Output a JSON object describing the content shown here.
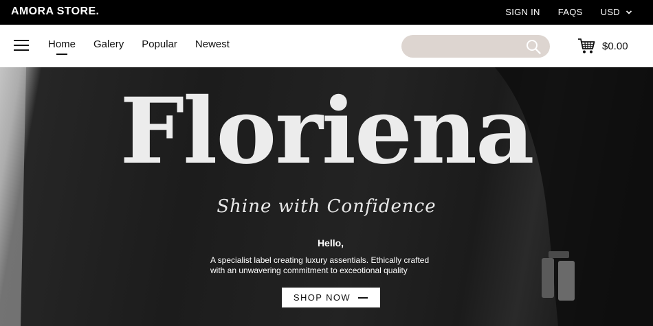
{
  "topbar": {
    "brand": "AMORA STORE.",
    "sign_in": "SIGN IN",
    "faqs": "FAQS",
    "currency": "USD",
    "currency_icon": "chevron-down-icon"
  },
  "nav": {
    "menu_icon": "hamburger-icon",
    "items": [
      {
        "label": "Home",
        "active": true
      },
      {
        "label": "Galery",
        "active": false
      },
      {
        "label": "Popular",
        "active": false
      },
      {
        "label": "Newest",
        "active": false
      }
    ],
    "search": {
      "placeholder": "",
      "value": "",
      "icon": "search-icon"
    },
    "cart": {
      "icon": "cart-icon",
      "total": "$0.00"
    }
  },
  "hero": {
    "title": "Floriena",
    "tagline": "Shine with Confidence",
    "greeting": "Hello,",
    "description_line1": "A specialist label creating luxury assentials. Ethically crafted",
    "description_line2": "with an unwavering commitment to exceotional quality",
    "cta_label": "SHOP NOW",
    "cta_icon": "arrow-right-icon"
  },
  "colors": {
    "topbar_bg": "#000000",
    "nav_bg": "#ffffff",
    "search_bg": "#ddd5d0",
    "hero_text": "#ececec"
  }
}
